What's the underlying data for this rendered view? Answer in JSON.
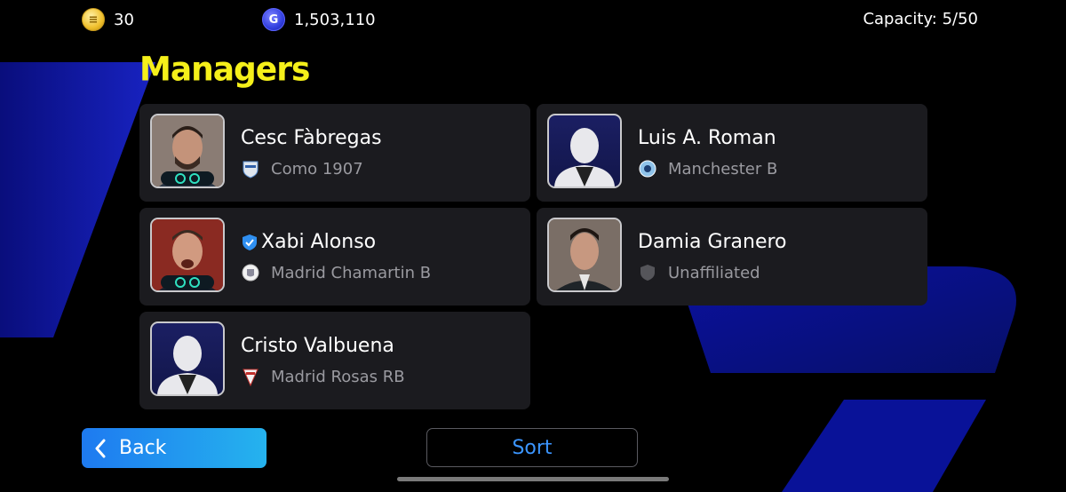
{
  "header": {
    "coins_value": "30",
    "gp_value": "1,503,110",
    "capacity_text": "Capacity: 5/50",
    "coin_icon": "efootball-coin-icon",
    "gp_icon": "gp-coin-icon"
  },
  "page_title": "Managers",
  "managers": [
    {
      "name": "Cesc Fàbregas",
      "club": "Como 1907",
      "portrait": "photo",
      "verified": false,
      "badged": true
    },
    {
      "name": "Luis A. Roman",
      "club": "Manchester B",
      "portrait": "silhouette",
      "verified": false,
      "badged": false
    },
    {
      "name": "Xabi Alonso",
      "club": "Madrid Chamartin B",
      "portrait": "photo",
      "verified": true,
      "badged": true
    },
    {
      "name": "Damia Granero",
      "club": "Unaffiliated",
      "portrait": "photo",
      "verified": false,
      "badged": false
    },
    {
      "name": "Cristo Valbuena",
      "club": "Madrid Rosas RB",
      "portrait": "silhouette",
      "verified": false,
      "badged": false
    }
  ],
  "footer": {
    "back_label": "Back",
    "sort_label": "Sort"
  },
  "colors": {
    "title": "#f5f01a",
    "accent_blue": "#1e7af0",
    "sort_text": "#3b95ff",
    "card_bg": "#1b1b1f"
  }
}
